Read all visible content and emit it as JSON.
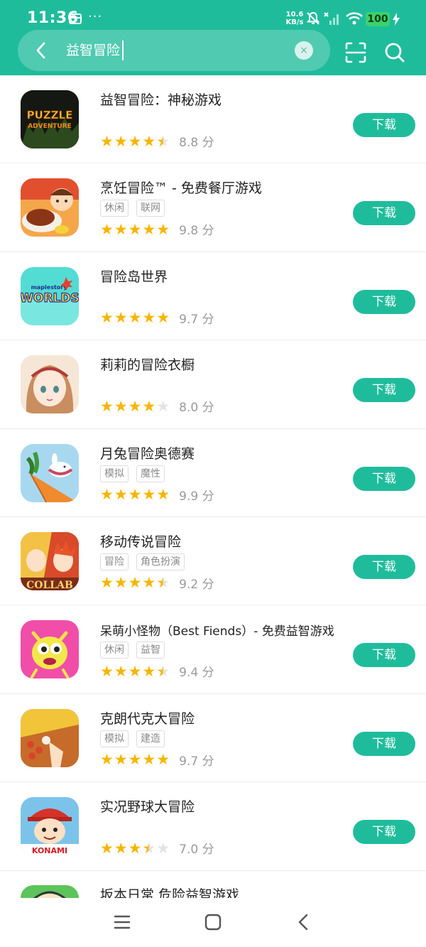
{
  "status": {
    "time": "11:36",
    "dots": "···",
    "speed_value": "10.6",
    "speed_unit": "KB/s",
    "battery": "100"
  },
  "search": {
    "query": "益智冒险",
    "clear_glyph": "×"
  },
  "colors": {
    "accent": "#1fbc9c",
    "star": "#f7b500",
    "star_empty": "#e3e3e3"
  },
  "apps": [
    {
      "name": "益智冒险：神秘游戏",
      "tags": [],
      "stars": [
        1,
        1,
        1,
        1,
        0.5
      ],
      "score": "8.8 分",
      "action": "下载"
    },
    {
      "name": "烹饪冒险™ - 免费餐厅游戏",
      "tags": [
        "休闲",
        "联网"
      ],
      "stars": [
        1,
        1,
        1,
        1,
        1
      ],
      "score": "9.8 分",
      "action": "下载"
    },
    {
      "name": "冒险岛世界",
      "tags": [],
      "stars": [
        1,
        1,
        1,
        1,
        1
      ],
      "score": "9.7 分",
      "action": "下载"
    },
    {
      "name": "莉莉的冒险衣橱",
      "tags": [],
      "stars": [
        1,
        1,
        1,
        1,
        0
      ],
      "score": "8.0 分",
      "action": "下载"
    },
    {
      "name": "月兔冒险奥德赛",
      "tags": [
        "模拟",
        "魔性"
      ],
      "stars": [
        1,
        1,
        1,
        1,
        1
      ],
      "score": "9.9 分",
      "action": "下载"
    },
    {
      "name": "移动传说冒险",
      "tags": [
        "冒险",
        "角色扮演"
      ],
      "stars": [
        1,
        1,
        1,
        1,
        0.5
      ],
      "score": "9.2 分",
      "action": "下载"
    },
    {
      "name": "呆萌小怪物（Best Fiends）- 免费益智游戏",
      "tags": [
        "休闲",
        "益智"
      ],
      "stars": [
        1,
        1,
        1,
        1,
        0.5
      ],
      "score": "9.4 分",
      "action": "下载"
    },
    {
      "name": "克朗代克大冒险",
      "tags": [
        "模拟",
        "建造"
      ],
      "stars": [
        1,
        1,
        1,
        1,
        1
      ],
      "score": "9.7 分",
      "action": "下载"
    },
    {
      "name": "实况野球大冒险",
      "tags": [],
      "stars": [
        1,
        1,
        1,
        0.5,
        0
      ],
      "score": "7.0 分",
      "action": "下载"
    }
  ],
  "partial_app": {
    "name": "坂本日常 危险益智游戏"
  },
  "icon_text": {
    "puzzle_line1": "PUZZLE",
    "puzzle_line2": "ADVENTURE",
    "maple_small": "maplestory",
    "maple_big": "WORLDS",
    "collab": "COLLAB",
    "konami": "KONAMI"
  }
}
